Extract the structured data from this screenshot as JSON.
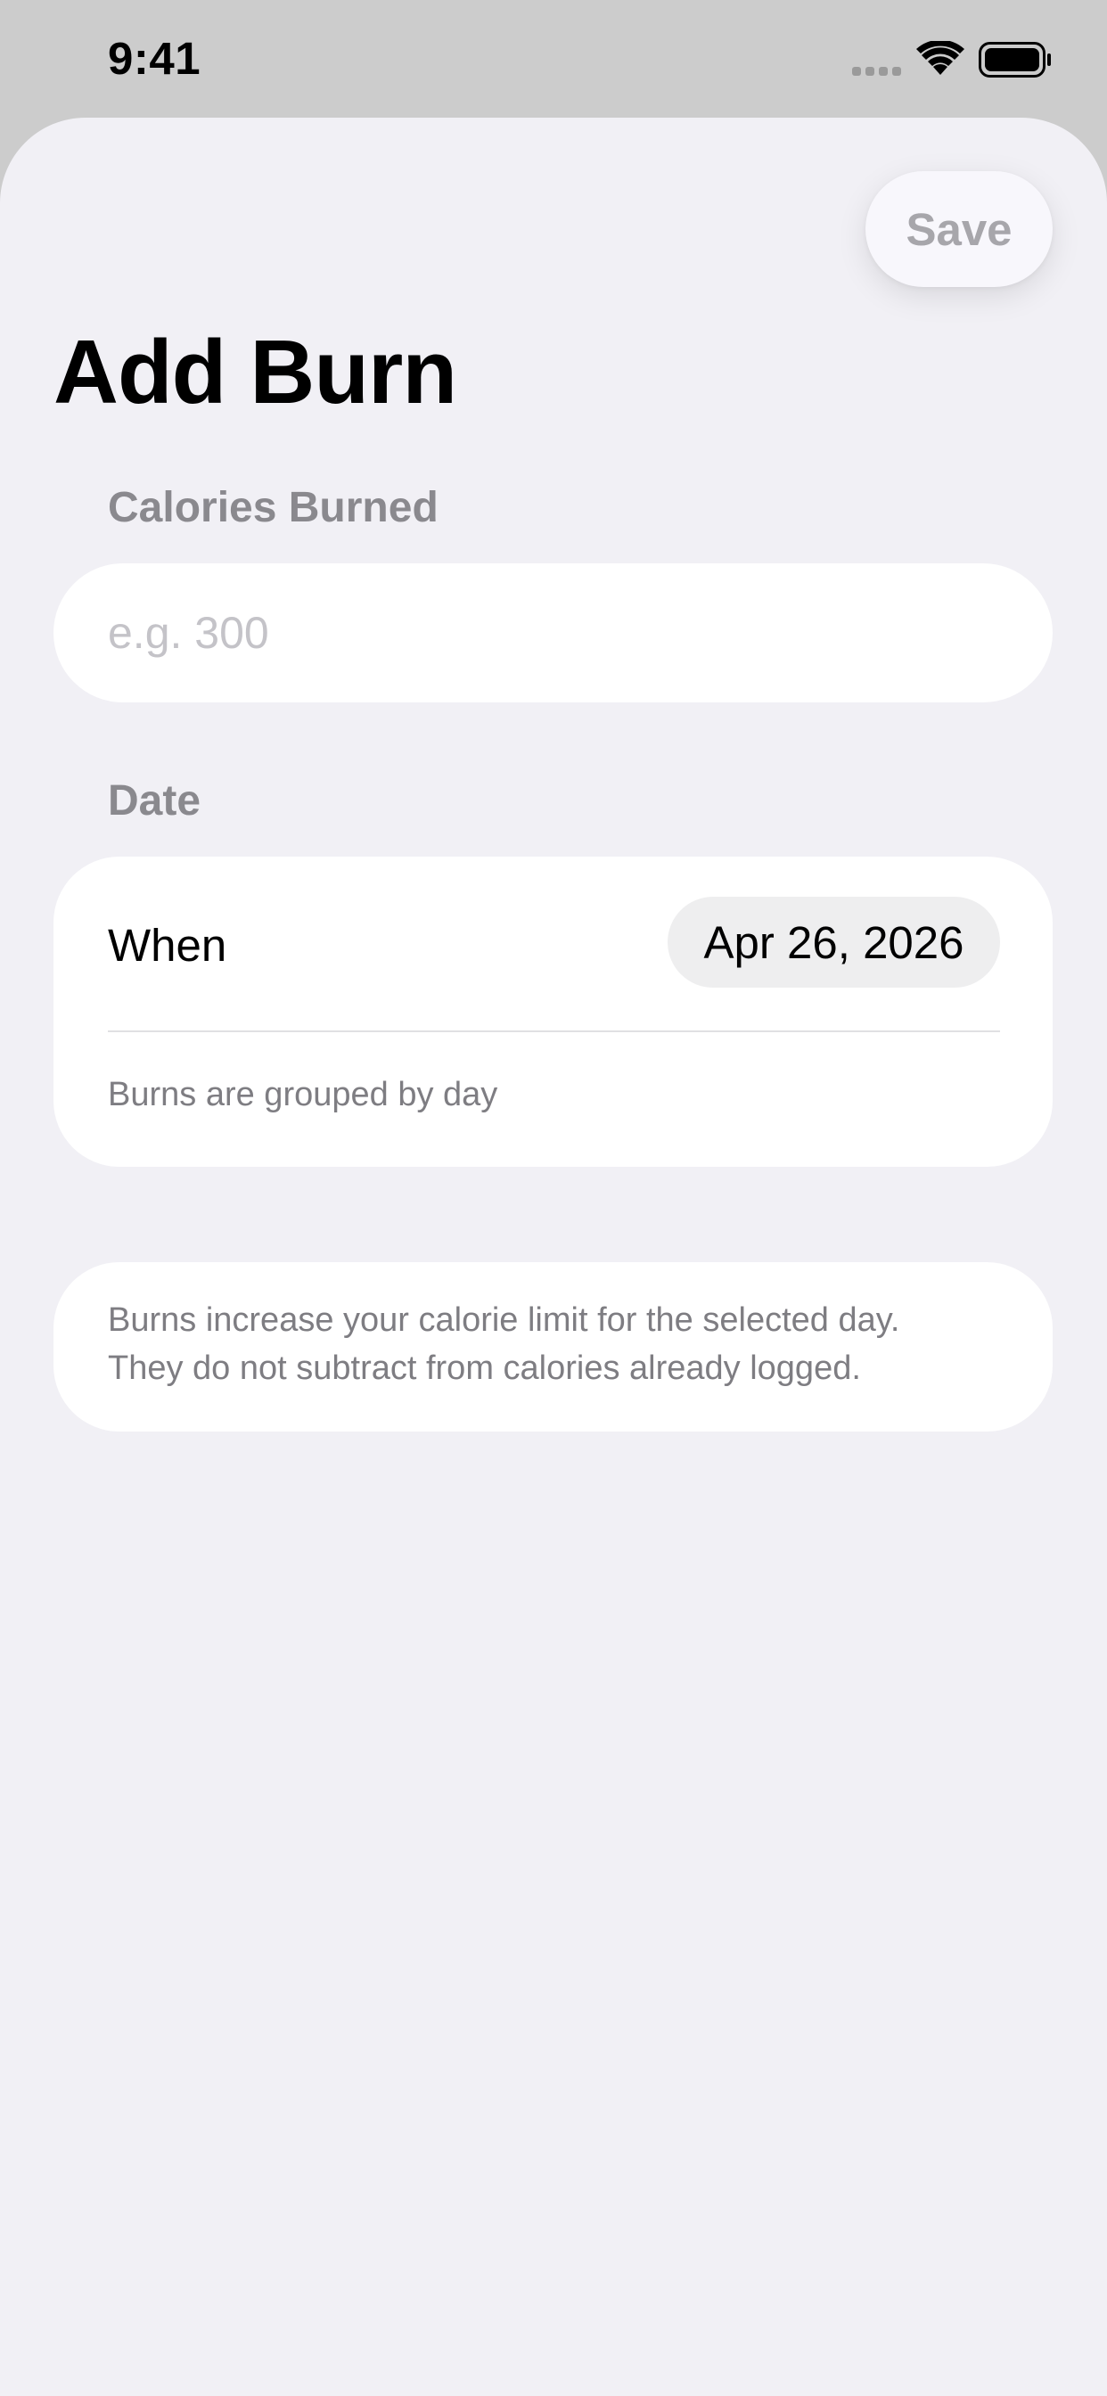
{
  "status_bar": {
    "time": "9:41",
    "icons": [
      "cellular-signal-icon",
      "wifi-icon",
      "battery-icon"
    ]
  },
  "sheet": {
    "save_label": "Save",
    "title": "Add Burn"
  },
  "calories": {
    "section_label": "Calories Burned",
    "value": "",
    "placeholder": "e.g. 300"
  },
  "date": {
    "section_label": "Date",
    "when_label": "When",
    "selected_date": "Apr 26, 2026",
    "note": "Burns are grouped by day"
  },
  "info": {
    "line1": "Burns increase your calorie limit for the selected day.",
    "line2": "They do not subtract from calories already logged."
  },
  "colors": {
    "sheet_background": "#f1f0f5",
    "card_background": "#ffffff",
    "secondary_text": "#8a898e",
    "disabled_save": "#a7a6ab"
  }
}
